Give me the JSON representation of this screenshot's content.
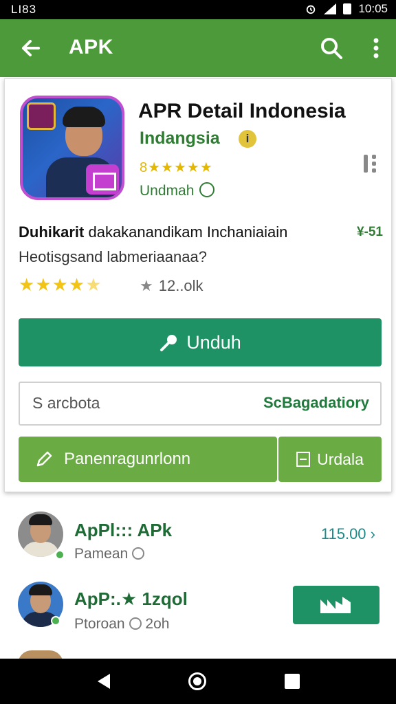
{
  "status_bar": {
    "left_text": "LI83",
    "time": "10:05"
  },
  "app_bar": {
    "title": "APK"
  },
  "app": {
    "title": "APR Detail Indonesia",
    "developer": "Indangsia",
    "rating_text": "8★★★★★",
    "install_label": "Undmah"
  },
  "description": {
    "line1_bold": "Duhikarit",
    "line1_rest": " dakakanandikam Inchaniaiain",
    "line2": "Heotisgsand labmeriaanaa?",
    "price_tag": "¥-51",
    "stars": "★★★★",
    "star_half": "★",
    "review_icon": "★",
    "review_count": "12..olk"
  },
  "actions": {
    "download_label": "Unduh",
    "search_placeholder": "S arcbota",
    "search_action": "ScBagadatiory",
    "recommend_label": "Panenragunrlonn",
    "data_label": "Urdala"
  },
  "list": {
    "items": [
      {
        "name": "ApPl::: APk",
        "sub": "Pamean",
        "price": "115.00 ›"
      },
      {
        "name": "ApP:.★ 1zqol",
        "sub": "Ptoroan",
        "sub_time": "2oh"
      }
    ]
  },
  "colors": {
    "app_bar": "#4c9a3a",
    "primary_button": "#1e9165",
    "secondary_button": "#6aab44",
    "accent_text": "#2e7d32"
  }
}
